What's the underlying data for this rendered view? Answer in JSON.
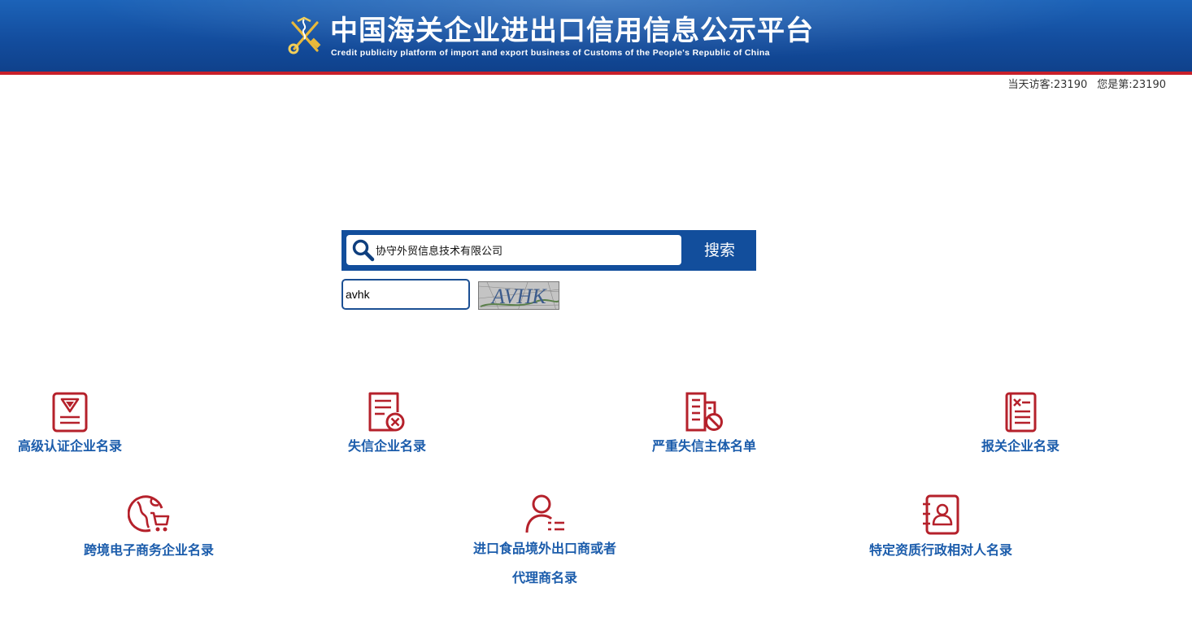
{
  "header": {
    "title_cn": "中国海关企业进出口信用信息公示平台",
    "title_en": "Credit publicity platform of import and export business of Customs of the People's Republic of China"
  },
  "counters": {
    "today_label": "当天访客:",
    "today_value": "23190",
    "you_label": "您是第:",
    "you_value": "23190"
  },
  "search": {
    "query_value": "协守外贸信息技术有限公司",
    "button_label": "搜索",
    "captcha_value": "avhk",
    "captcha_image_text": "AVHK"
  },
  "categories": {
    "row1": [
      {
        "label": "高级认证企业名录",
        "icon": "certificate-icon"
      },
      {
        "label": "失信企业名录",
        "icon": "document-x-icon"
      },
      {
        "label": "严重失信主体名单",
        "icon": "building-ban-icon"
      },
      {
        "label": "报关企业名录",
        "icon": "notebook-tools-icon"
      }
    ],
    "row2": [
      {
        "label": "跨境电子商务企业名录",
        "icon": "globe-cart-icon"
      },
      {
        "label_line1": "进口食品境外出口商或者",
        "label_line2": "代理商名录",
        "icon": "person-list-icon"
      },
      {
        "label": "特定资质行政相对人名录",
        "icon": "contact-book-icon"
      }
    ]
  },
  "colors": {
    "header_blue": "#134d9e",
    "header_red_line": "#c8202a",
    "icon_red": "#b5212b",
    "label_blue": "#1b5cab"
  }
}
